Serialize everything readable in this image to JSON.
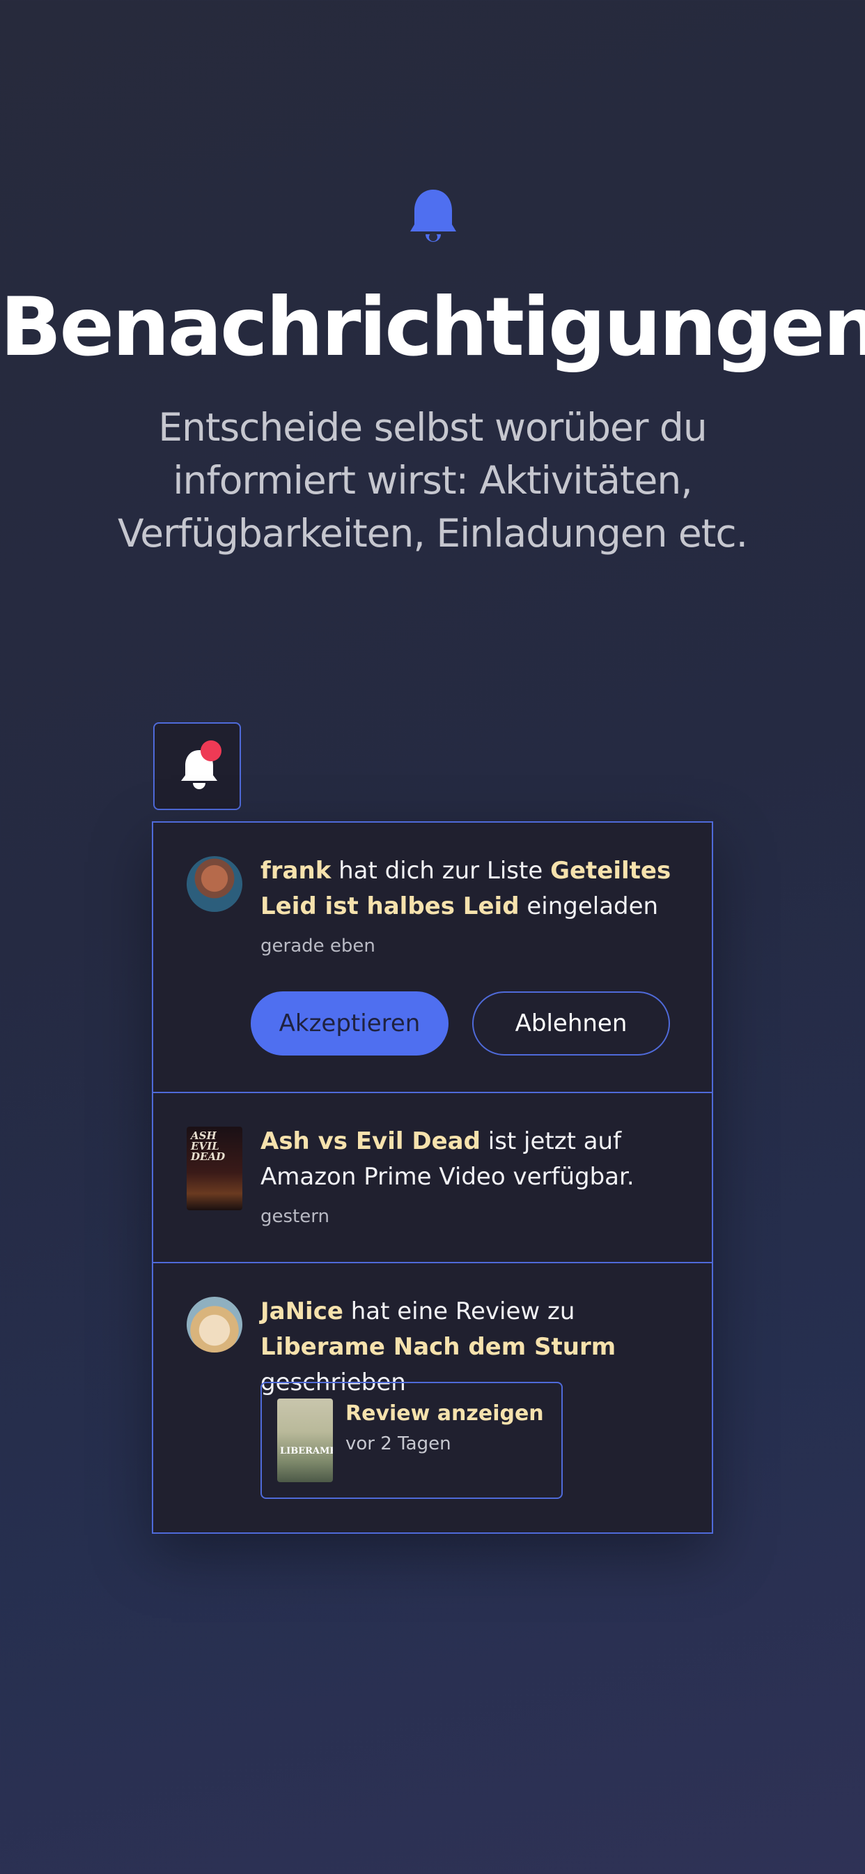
{
  "header": {
    "icon": "bell-icon",
    "title": "Benachrichtigungen",
    "subtitle": "Entscheide selbst worüber du informiert wirst: Aktivitäten, Verfügbarkeiten, Einladungen etc."
  },
  "bell_button": {
    "icon": "bell-icon",
    "has_unread": true
  },
  "notifications": [
    {
      "avatar": "avatar-frank",
      "user": "frank",
      "text_1": " hat dich zur Liste ",
      "list": "Geteiltes Leid ist halbes Leid",
      "text_2": " eingeladen",
      "time": "gerade eben",
      "accept_label": "Akzeptieren",
      "decline_label": "Ablehnen"
    },
    {
      "poster": "poster-ash-vs-evil-dead",
      "poster_text": "ASH EVIL DEAD",
      "title": "Ash vs Evil Dead",
      "text": "  ist jetzt auf Amazon Prime Video verfügbar.",
      "time": "gestern"
    },
    {
      "avatar": "avatar-janice",
      "user": "JaNice",
      "text_1": " hat eine Review zu ",
      "title": "Liberame Nach dem Sturm",
      "text_2": " geschrieben",
      "review": {
        "thumb_text": "LIBERAME",
        "label": "Review anzeigen",
        "time": "vor 2 Tagen"
      }
    }
  ],
  "colors": {
    "accent": "#4f6ff0",
    "border": "#4f6ad9",
    "highlight": "#f6e2ad",
    "badge": "#ee3a55",
    "panel": "#20202f"
  }
}
